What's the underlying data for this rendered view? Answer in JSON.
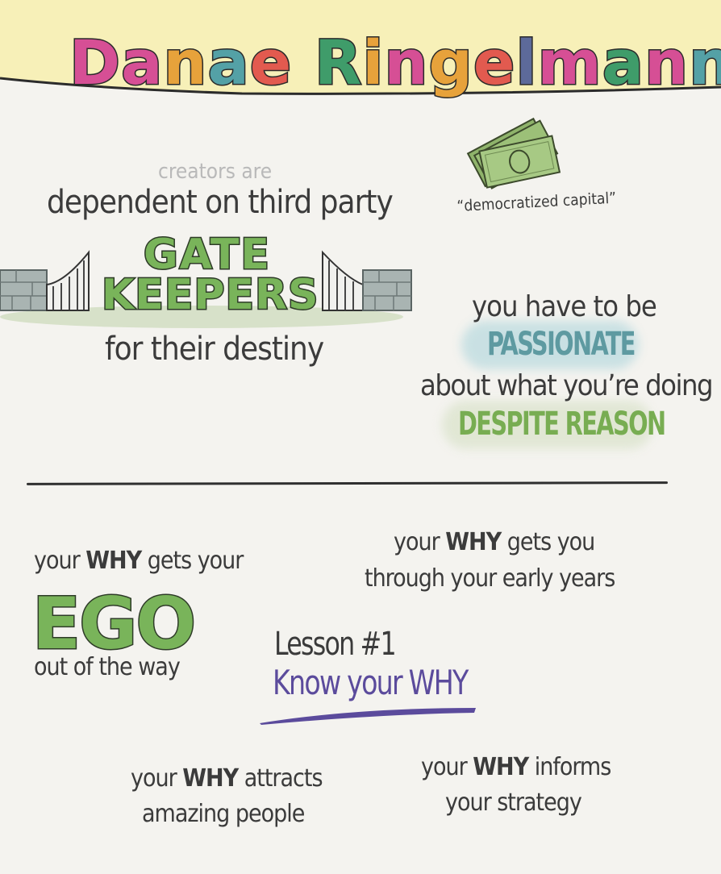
{
  "title": {
    "letters": [
      {
        "ch": "D",
        "color": "#d64f95"
      },
      {
        "ch": "a",
        "color": "#d64f95"
      },
      {
        "ch": "n",
        "color": "#e7a23b"
      },
      {
        "ch": "a",
        "color": "#54a1a6"
      },
      {
        "ch": "e",
        "color": "#e25a4f"
      },
      {
        "ch": " ",
        "color": "#000000"
      },
      {
        "ch": "R",
        "color": "#3f9c6a"
      },
      {
        "ch": "i",
        "color": "#e7a23b"
      },
      {
        "ch": "n",
        "color": "#d64f95"
      },
      {
        "ch": "g",
        "color": "#e7a23b"
      },
      {
        "ch": "e",
        "color": "#e25a4f"
      },
      {
        "ch": "l",
        "color": "#5d6a9a"
      },
      {
        "ch": "m",
        "color": "#d64f95"
      },
      {
        "ch": "a",
        "color": "#3f9c6a"
      },
      {
        "ch": "n",
        "color": "#d64f95"
      },
      {
        "ch": "n",
        "color": "#54a1a6"
      }
    ]
  },
  "gatekeepers": {
    "intro": "creators are",
    "line1": "dependent on third party",
    "big1": "GATE",
    "big2": "KEEPERS",
    "line2": "for their destiny"
  },
  "capital": {
    "caption": "“democratized capital”"
  },
  "passion": {
    "line1": "you have to be",
    "word1": "PASSIONATE",
    "line2": "about what you’re doing",
    "word2": "DESPITE REASON"
  },
  "ego": {
    "pre": "your ",
    "why": "WHY",
    "post": " gets your",
    "big": "EGO",
    "tail": "out of the way"
  },
  "early": {
    "pre": "your ",
    "why": "WHY",
    "post": " gets you",
    "line2": "through your early years"
  },
  "lesson": {
    "label": "Lesson #1",
    "text": "Know your WHY"
  },
  "attracts": {
    "pre": "your ",
    "why": "WHY",
    "post": " attracts",
    "line2": "amazing people"
  },
  "informs": {
    "pre": "your ",
    "why": "WHY",
    "post": " informs",
    "line2": "your strategy"
  },
  "colors": {
    "paper": "#f4f3ef",
    "header": "#f7f0b8",
    "green": "#79b45a",
    "teal": "#5e9aa1",
    "purple": "#5b4b9c"
  }
}
